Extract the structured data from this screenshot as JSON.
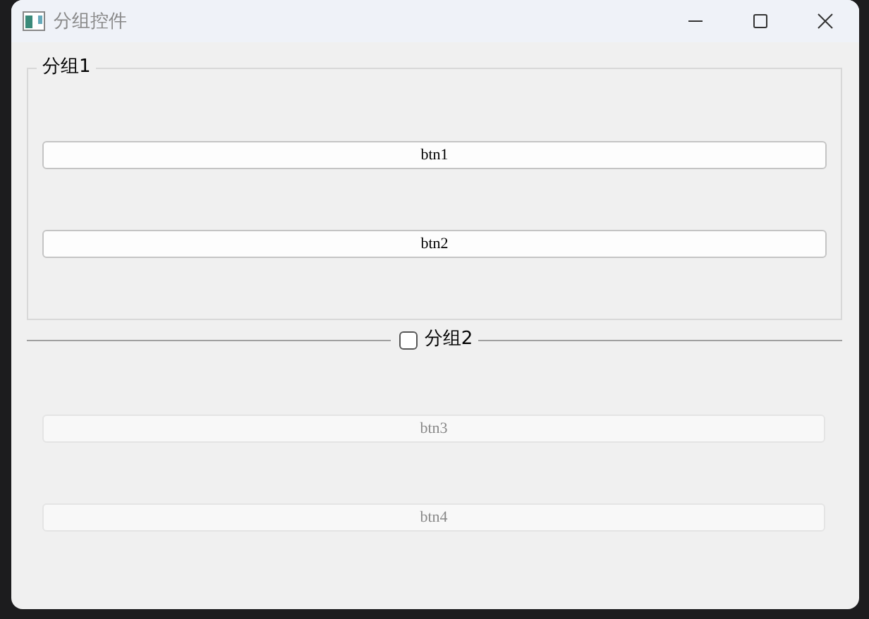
{
  "window": {
    "title": "分组控件"
  },
  "groups": [
    {
      "kind": "box",
      "title": "分组1",
      "buttons": [
        {
          "label": "btn1",
          "disabled": false
        },
        {
          "label": "btn2",
          "disabled": false
        }
      ]
    },
    {
      "kind": "checkable",
      "title": "分组2",
      "checked": false,
      "buttons": [
        {
          "label": "btn3",
          "disabled": true
        },
        {
          "label": "btn4",
          "disabled": true
        }
      ]
    }
  ]
}
